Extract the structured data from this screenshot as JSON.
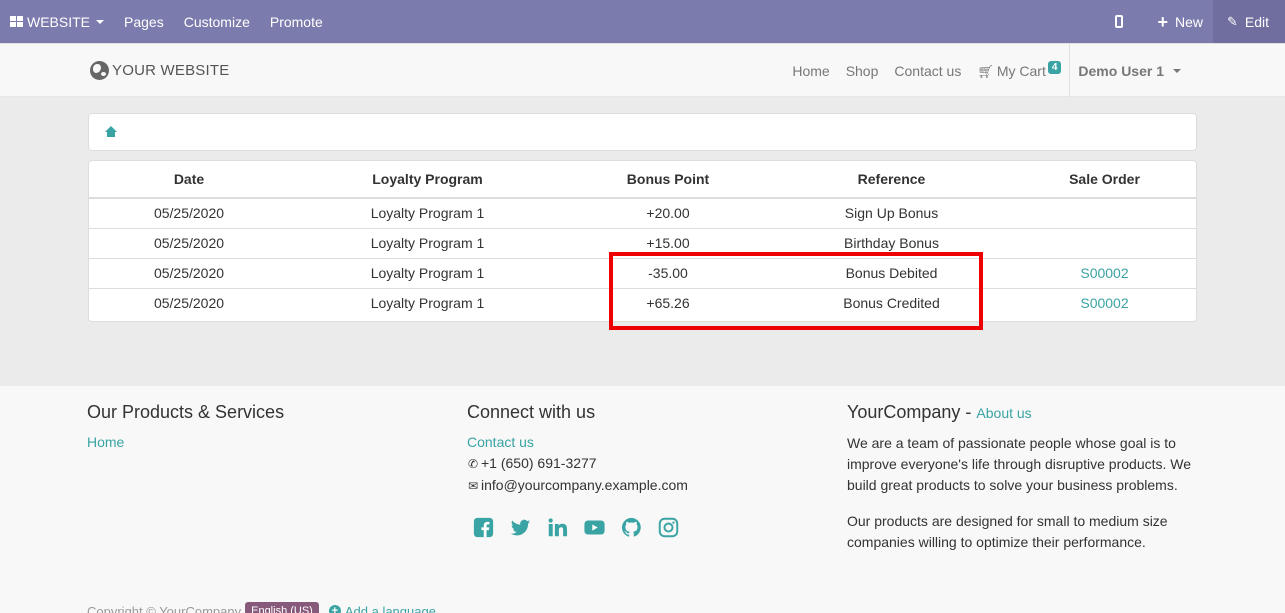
{
  "topbar": {
    "website_label": "WEBSITE",
    "menu": [
      "Pages",
      "Customize",
      "Promote"
    ],
    "new_label": "New",
    "edit_label": "Edit"
  },
  "header": {
    "logo_text": "YOUR WEBSITE",
    "nav": [
      "Home",
      "Shop",
      "Contact us"
    ],
    "cart_label": "My Cart",
    "cart_count": "4",
    "user_label": "Demo User 1"
  },
  "table": {
    "headers": [
      "Date",
      "Loyalty Program",
      "Bonus Point",
      "Reference",
      "Sale Order"
    ],
    "rows": [
      [
        "05/25/2020",
        "Loyalty Program 1",
        "+20.00",
        "Sign Up Bonus",
        ""
      ],
      [
        "05/25/2020",
        "Loyalty Program 1",
        "+15.00",
        "Birthday Bonus",
        ""
      ],
      [
        "05/25/2020",
        "Loyalty Program 1",
        "-35.00",
        "Bonus Debited",
        "S00002"
      ],
      [
        "05/25/2020",
        "Loyalty Program 1",
        "+65.26",
        "Bonus Credited",
        "S00002"
      ]
    ]
  },
  "footer": {
    "col1": {
      "title": "Our Products & Services",
      "link": "Home"
    },
    "col2": {
      "title": "Connect with us",
      "contact_link": "Contact us",
      "phone": "+1 (650) 691-3277",
      "email": "info@yourcompany.example.com"
    },
    "col3": {
      "title": "YourCompany",
      "sep": " - ",
      "about_link": "About us",
      "para1": "We are a team of passionate people whose goal is to improve everyone's life through disruptive products. We build great products to solve your business problems.",
      "para2": "Our products are designed for small to medium size companies willing to optimize their performance."
    },
    "copyright": "Copyright © YourCompany",
    "language": "English (US)",
    "add_language": "Add a language"
  },
  "colors": {
    "topbar": "#7c7bad",
    "accent": "#3aa3a3",
    "highlight": "#ee0000"
  }
}
